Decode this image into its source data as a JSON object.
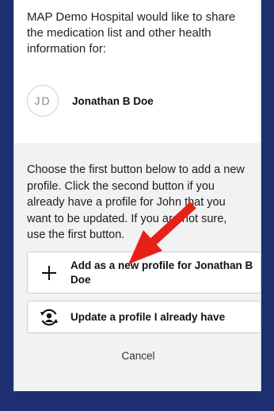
{
  "intro": {
    "text": "MAP Demo Hospital would like to share the medication list and other health information for:"
  },
  "profile": {
    "initials": "JD",
    "name": "Jonathan B Doe"
  },
  "instructions": {
    "text": "Choose the first button below to add a new profile. Click the second button if you already have a profile for John that you want to be updated. If you are not sure, use the first button."
  },
  "buttons": {
    "add_new_label": "Add as a new profile for Jonathan B Doe",
    "update_label": "Update a profile I already have",
    "cancel_label": "Cancel"
  },
  "icons": {
    "plus": "plus-icon",
    "update_profile": "profile-sync-icon",
    "annotation_arrow": "red-arrow"
  },
  "colors": {
    "background": "#1c2f6e",
    "arrow": "#e8201a"
  }
}
